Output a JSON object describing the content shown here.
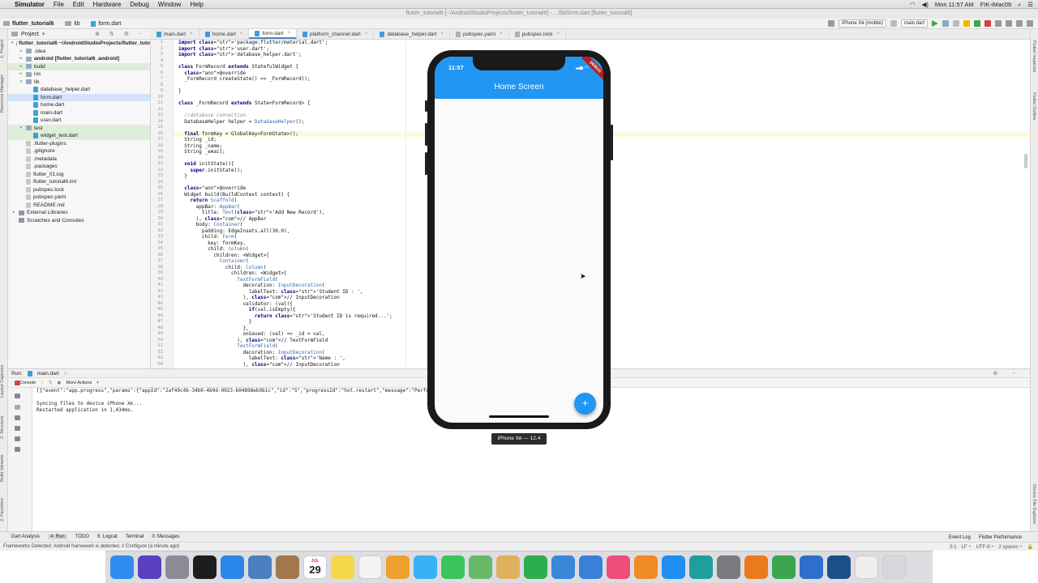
{
  "menubar": {
    "apple": "",
    "items": [
      "Simulator",
      "File",
      "Edit",
      "Hardware",
      "Debug",
      "Window",
      "Help"
    ],
    "clock": "Mon 11:57 AM",
    "user": "FIK-iMac09"
  },
  "window_title": "flutter_tutorial6 [~/AndroidStudioProjects/flutter_tutorial6] - .../lib/form.dart [flutter_tutorial6]",
  "navbar": {
    "crumbs": [
      "flutter_tutorial6",
      "lib",
      "form.dart"
    ],
    "device": "iPhone Xʀ (mobile)",
    "run_config": "main.dart"
  },
  "project": {
    "header": "Project",
    "tree": [
      {
        "label": "flutter_tutorial6 ~/AndroidStudioProjects/flutter_tuto",
        "icon": "folder",
        "indent": 0,
        "tw": "▾",
        "bold": true
      },
      {
        "label": ".idea",
        "icon": "folder",
        "indent": 1,
        "tw": "▸"
      },
      {
        "label": "android [flutter_tutorial6_android]",
        "icon": "folder",
        "indent": 1,
        "tw": "▸",
        "bold": true
      },
      {
        "label": "build",
        "icon": "folder",
        "indent": 1,
        "tw": "▸",
        "hl": true
      },
      {
        "label": "ios",
        "icon": "folder",
        "indent": 1,
        "tw": "▸"
      },
      {
        "label": "lib",
        "icon": "folder",
        "indent": 1,
        "tw": "▾"
      },
      {
        "label": "database_helper.dart",
        "icon": "dart",
        "indent": 2,
        "tw": ""
      },
      {
        "label": "form.dart",
        "icon": "dart",
        "indent": 2,
        "tw": ""
      },
      {
        "label": "home.dart",
        "icon": "dart",
        "indent": 2,
        "tw": ""
      },
      {
        "label": "main.dart",
        "icon": "dart",
        "indent": 2,
        "tw": ""
      },
      {
        "label": "user.dart",
        "icon": "dart",
        "indent": 2,
        "tw": ""
      },
      {
        "label": "test",
        "icon": "folder",
        "indent": 1,
        "tw": "▾",
        "hl": true
      },
      {
        "label": "widget_test.dart",
        "icon": "dart",
        "indent": 2,
        "tw": "",
        "hl": true
      },
      {
        "label": ".flutter-plugins",
        "icon": "file",
        "indent": 1,
        "tw": ""
      },
      {
        "label": ".gitignore",
        "icon": "file",
        "indent": 1,
        "tw": ""
      },
      {
        "label": ".metadata",
        "icon": "file",
        "indent": 1,
        "tw": ""
      },
      {
        "label": ".packages",
        "icon": "file",
        "indent": 1,
        "tw": ""
      },
      {
        "label": "flutter_01.log",
        "icon": "file",
        "indent": 1,
        "tw": ""
      },
      {
        "label": "flutter_tutorial6.iml",
        "icon": "file",
        "indent": 1,
        "tw": ""
      },
      {
        "label": "pubspec.lock",
        "icon": "file",
        "indent": 1,
        "tw": ""
      },
      {
        "label": "pubspec.yaml",
        "icon": "file",
        "indent": 1,
        "tw": ""
      },
      {
        "label": "README.md",
        "icon": "file",
        "indent": 1,
        "tw": ""
      },
      {
        "label": "External Libraries",
        "icon": "lib",
        "indent": 0,
        "tw": "▸"
      },
      {
        "label": "Scratches and Consoles",
        "icon": "lib",
        "indent": 0,
        "tw": ""
      }
    ]
  },
  "tabs": [
    "main.dart",
    "home.dart",
    "form.dart",
    "platform_channel.dart",
    "database_helper.dart",
    "pubspec.yaml",
    "pubspec.lock"
  ],
  "active_tab": 2,
  "code": [
    "import 'package:flutter/material.dart';",
    "import 'user.dart';",
    "import 'database_helper.dart';",
    "",
    "class FormRecord extends StatefulWidget {",
    "  @override",
    "  _FormRecord createState() => _FormRecord();",
    "",
    "}",
    "",
    "class _FormRecord extends State<FormRecord> {",
    "",
    "  //database connection",
    "  DatabaseHelper helper = DatabaseHelper();",
    "",
    "  final formKey = GlobalKey<FormState>();",
    "  String _id;",
    "  String _name;",
    "  String _email;",
    "",
    "  void initState(){",
    "    super.initState();",
    "  }",
    "",
    "  @override",
    "  Widget build(BuildContext context) {",
    "    return Scaffold(",
    "      appBar: AppBar(",
    "        title: Text('Add New Record'),",
    "      ), // AppBar",
    "      body: Container(",
    "        padding: EdgeInsets.all(30.0),",
    "        child: Form(",
    "          key: formKey,",
    "          child: Column(",
    "            children: <Widget>[",
    "              Container(",
    "                child: Column(",
    "                  children: <Widget>[",
    "                    TextFormField(",
    "                      decoration: InputDecoration(",
    "                        labelText: 'Student ID : ',",
    "                      ), // InputDecoration",
    "                      validator: (val){",
    "                        if(val.isEmpty){",
    "                          return 'Student ID is required...';",
    "                        }",
    "                      },",
    "                      onSaved: (val) => _id = val,",
    "                    ), // TextFormField",
    "                    TextFormField(",
    "                      decoration: InputDecoration(",
    "                        labelText: 'Name : ',",
    "                      ), // InputDecoration"
  ],
  "run": {
    "label": "Run:",
    "config": "main.dart",
    "console_tab": "Console",
    "more_actions": "More Actions",
    "lines": [
      "[{\"event\":\"app.progress\",\"params\":{\"appId\":\"2af49c4b-34b0-4b9d-9023-b04898eb9b1c\",\"id\":\"5\",\"progressId\":\"hot.restart\",\"message\":\"Performing hot restart...\"}}]",
      "",
      "Syncing files to device iPhone Xʀ...",
      "Restarted application in 1,434ms."
    ]
  },
  "toolwindows": [
    "Dart Analysis",
    "4: Run",
    "TODO",
    "6: Logcat",
    "Terminal",
    "0: Messages"
  ],
  "toolwindows_right": [
    "Event Log",
    "Flutter Performance"
  ],
  "statusbar": {
    "message": "Frameworks Detected: Android framework is detected. // Configure (a minute ago)",
    "position": "5:1",
    "lf": "LF ÷",
    "encoding": "UTF-8 ÷",
    "indent": "2 spaces ÷"
  },
  "leftstrip": [
    "1: Project",
    "Resource Manager",
    "Layout Captures",
    "2: Structure",
    "Build Variants",
    "2: Favorites"
  ],
  "rightstrip": [
    "Flutter Inspector",
    "Flutter Outline",
    "Device File Explorer"
  ],
  "simulator": {
    "time": "11:57",
    "app_title": "Home Screen",
    "debug_banner": "DEBUG",
    "fab_icon": "+",
    "device_label": "iPhone Xʀ — 12.4"
  },
  "dock": {
    "calendar_day": "29",
    "calendar_month": "JUL",
    "apps": [
      {
        "name": "finder",
        "color": "#2f8df0"
      },
      {
        "name": "siri",
        "color": "#5a3fc0"
      },
      {
        "name": "launchpad",
        "color": "#8b8b95"
      },
      {
        "name": "terminal",
        "color": "#1d1d1d"
      },
      {
        "name": "safari",
        "color": "#2a86e8"
      },
      {
        "name": "xcode-preview",
        "color": "#4a7fc0"
      },
      {
        "name": "notefile",
        "color": "#a0784a"
      },
      {
        "name": "calendar",
        "color": "#ffffff"
      },
      {
        "name": "notes",
        "color": "#f6d64a"
      },
      {
        "name": "reminders",
        "color": "#f4f4f4"
      },
      {
        "name": "photos",
        "color": "#f0a030"
      },
      {
        "name": "messages",
        "color": "#38b2f5"
      },
      {
        "name": "facetime",
        "color": "#3ac45a"
      },
      {
        "name": "maps",
        "color": "#67b96a"
      },
      {
        "name": "preview",
        "color": "#e0b060"
      },
      {
        "name": "numbers",
        "color": "#2dae4e"
      },
      {
        "name": "keynote",
        "color": "#3b86d9"
      },
      {
        "name": "xcode",
        "color": "#3a80d9"
      },
      {
        "name": "itunes",
        "color": "#ee4d7a"
      },
      {
        "name": "books",
        "color": "#f08a24"
      },
      {
        "name": "app-store",
        "color": "#1f8ef0"
      },
      {
        "name": "maya",
        "color": "#1e9e9e"
      },
      {
        "name": "system-preferences",
        "color": "#7a7a80"
      },
      {
        "name": "blender",
        "color": "#eb7a1c"
      },
      {
        "name": "android-studio",
        "color": "#3ca64e"
      },
      {
        "name": "simulator",
        "color": "#2f6fcc"
      },
      {
        "name": "quicktime",
        "color": "#1b4f8a"
      },
      {
        "name": "document",
        "color": "#eeeeee"
      },
      {
        "name": "trash",
        "color": "#d8d8dc"
      }
    ]
  }
}
